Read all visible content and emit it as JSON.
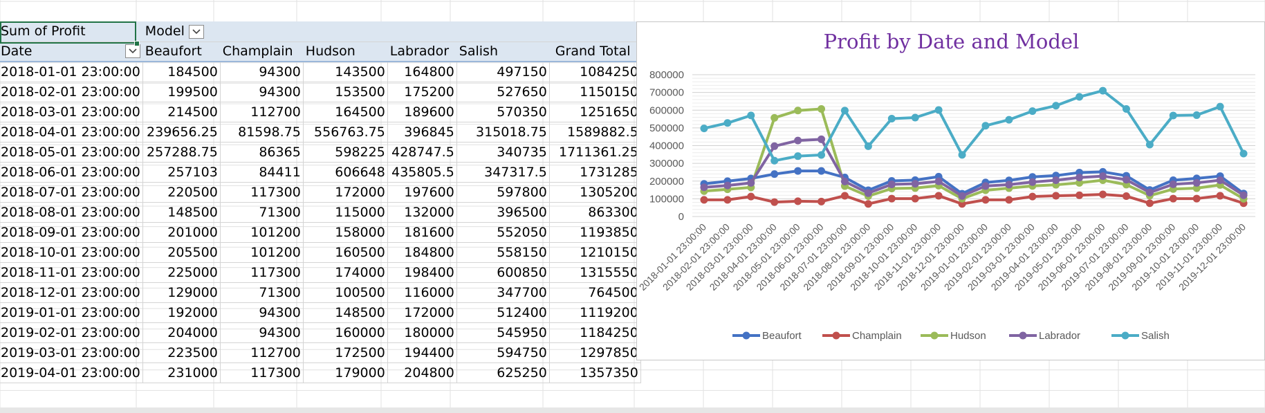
{
  "pivot": {
    "corner_label": "Sum of Profit",
    "column_field_label": "Model",
    "row_field_label": "Date",
    "columns": [
      "Beaufort",
      "Champlain",
      "Hudson",
      "Labrador",
      "Salish",
      "Grand Total"
    ],
    "rows": [
      {
        "date": "2018-01-01 23:00:00",
        "values": [
          "184500",
          "94300",
          "143500",
          "164800",
          "497150",
          "1084250"
        ]
      },
      {
        "date": "2018-02-01 23:00:00",
        "values": [
          "199500",
          "94300",
          "153500",
          "175200",
          "527650",
          "1150150"
        ]
      },
      {
        "date": "2018-03-01 23:00:00",
        "values": [
          "214500",
          "112700",
          "164500",
          "189600",
          "570350",
          "1251650"
        ]
      },
      {
        "date": "2018-04-01 23:00:00",
        "values": [
          "239656.25",
          "81598.75",
          "556763.75",
          "396845",
          "315018.75",
          "1589882.5"
        ]
      },
      {
        "date": "2018-05-01 23:00:00",
        "values": [
          "257288.75",
          "86365",
          "598225",
          "428747.5",
          "340735",
          "1711361.25"
        ]
      },
      {
        "date": "2018-06-01 23:00:00",
        "values": [
          "257103",
          "84411",
          "606648",
          "435805.5",
          "347317.5",
          "1731285"
        ]
      },
      {
        "date": "2018-07-01 23:00:00",
        "values": [
          "220500",
          "117300",
          "172000",
          "197600",
          "597800",
          "1305200"
        ]
      },
      {
        "date": "2018-08-01 23:00:00",
        "values": [
          "148500",
          "71300",
          "115000",
          "132000",
          "396500",
          "863300"
        ]
      },
      {
        "date": "2018-09-01 23:00:00",
        "values": [
          "201000",
          "101200",
          "158000",
          "181600",
          "552050",
          "1193850"
        ]
      },
      {
        "date": "2018-10-01 23:00:00",
        "values": [
          "205500",
          "101200",
          "160500",
          "184800",
          "558150",
          "1210150"
        ]
      },
      {
        "date": "2018-11-01 23:00:00",
        "values": [
          "225000",
          "117300",
          "174000",
          "198400",
          "600850",
          "1315550"
        ]
      },
      {
        "date": "2018-12-01 23:00:00",
        "values": [
          "129000",
          "71300",
          "100500",
          "116000",
          "347700",
          "764500"
        ]
      },
      {
        "date": "2019-01-01 23:00:00",
        "values": [
          "192000",
          "94300",
          "148500",
          "172000",
          "512400",
          "1119200"
        ]
      },
      {
        "date": "2019-02-01 23:00:00",
        "values": [
          "204000",
          "94300",
          "160000",
          "180000",
          "545950",
          "1184250"
        ]
      },
      {
        "date": "2019-03-01 23:00:00",
        "values": [
          "223500",
          "112700",
          "172500",
          "194400",
          "594750",
          "1297850"
        ]
      },
      {
        "date": "2019-04-01 23:00:00",
        "values": [
          "231000",
          "117300",
          "179000",
          "204800",
          "625250",
          "1357350"
        ]
      }
    ]
  },
  "chart_data": {
    "type": "line",
    "title": "Profit by Date and Model",
    "xlabel": "",
    "ylabel": "",
    "ylim": [
      0,
      800000
    ],
    "yticks": [
      0,
      100000,
      200000,
      300000,
      400000,
      500000,
      600000,
      700000,
      800000
    ],
    "grid": true,
    "legend_position": "bottom",
    "categories": [
      "2018-01-01 23:00:00",
      "2018-02-01 23:00:00",
      "2018-03-01 23:00:00",
      "2018-04-01 23:00:00",
      "2018-05-01 23:00:00",
      "2018-06-01 23:00:00",
      "2018-07-01 23:00:00",
      "2018-08-01 23:00:00",
      "2018-09-01 23:00:00",
      "2018-10-01 23:00:00",
      "2018-11-01 23:00:00",
      "2018-12-01 23:00:00",
      "2019-01-01 23:00:00",
      "2019-02-01 23:00:00",
      "2019-03-01 23:00:00",
      "2019-04-01 23:00:00",
      "2019-05-01 23:00:00",
      "2019-06-01 23:00:00",
      "2019-07-01 23:00:00",
      "2019-08-01 23:00:00",
      "2019-09-01 23:00:00",
      "2019-10-01 23:00:00",
      "2019-11-01 23:00:00",
      "2019-12-01 23:00:00"
    ],
    "series": [
      {
        "name": "Beaufort",
        "color": "#4472c4",
        "values": [
          184500,
          199500,
          214500,
          239656.25,
          257288.75,
          257103,
          220500,
          148500,
          201000,
          205500,
          225000,
          129000,
          192000,
          204000,
          223500,
          231000,
          248000,
          252000,
          230000,
          150000,
          205000,
          215000,
          228000,
          130000
        ]
      },
      {
        "name": "Champlain",
        "color": "#c0504d",
        "values": [
          94300,
          94300,
          112700,
          81598.75,
          86365,
          84411,
          117300,
          71300,
          101200,
          101200,
          117300,
          71300,
          94300,
          94300,
          112700,
          117300,
          120000,
          125000,
          115000,
          75000,
          101200,
          101200,
          117300,
          75000
        ]
      },
      {
        "name": "Hudson",
        "color": "#9bbb59",
        "values": [
          143500,
          153500,
          164500,
          556763.75,
          598225,
          606648,
          172000,
          115000,
          158000,
          160500,
          174000,
          100500,
          148500,
          160000,
          172500,
          179000,
          190000,
          205000,
          180000,
          118000,
          155000,
          160000,
          178000,
          100000
        ]
      },
      {
        "name": "Labrador",
        "color": "#8064a2",
        "values": [
          164800,
          175200,
          189600,
          396845,
          428747.5,
          435805.5,
          197600,
          132000,
          181600,
          184800,
          198400,
          116000,
          172000,
          180000,
          194400,
          204800,
          220000,
          228000,
          208000,
          135000,
          182000,
          190000,
          205000,
          120000
        ]
      },
      {
        "name": "Salish",
        "color": "#4bacc6",
        "values": [
          497150,
          527650,
          570350,
          315018.75,
          340735,
          347317.5,
          597800,
          396500,
          552050,
          558150,
          600850,
          347700,
          512400,
          545950,
          594750,
          625250,
          675000,
          710000,
          607000,
          406000,
          570000,
          572000,
          620000,
          355000
        ]
      }
    ]
  }
}
